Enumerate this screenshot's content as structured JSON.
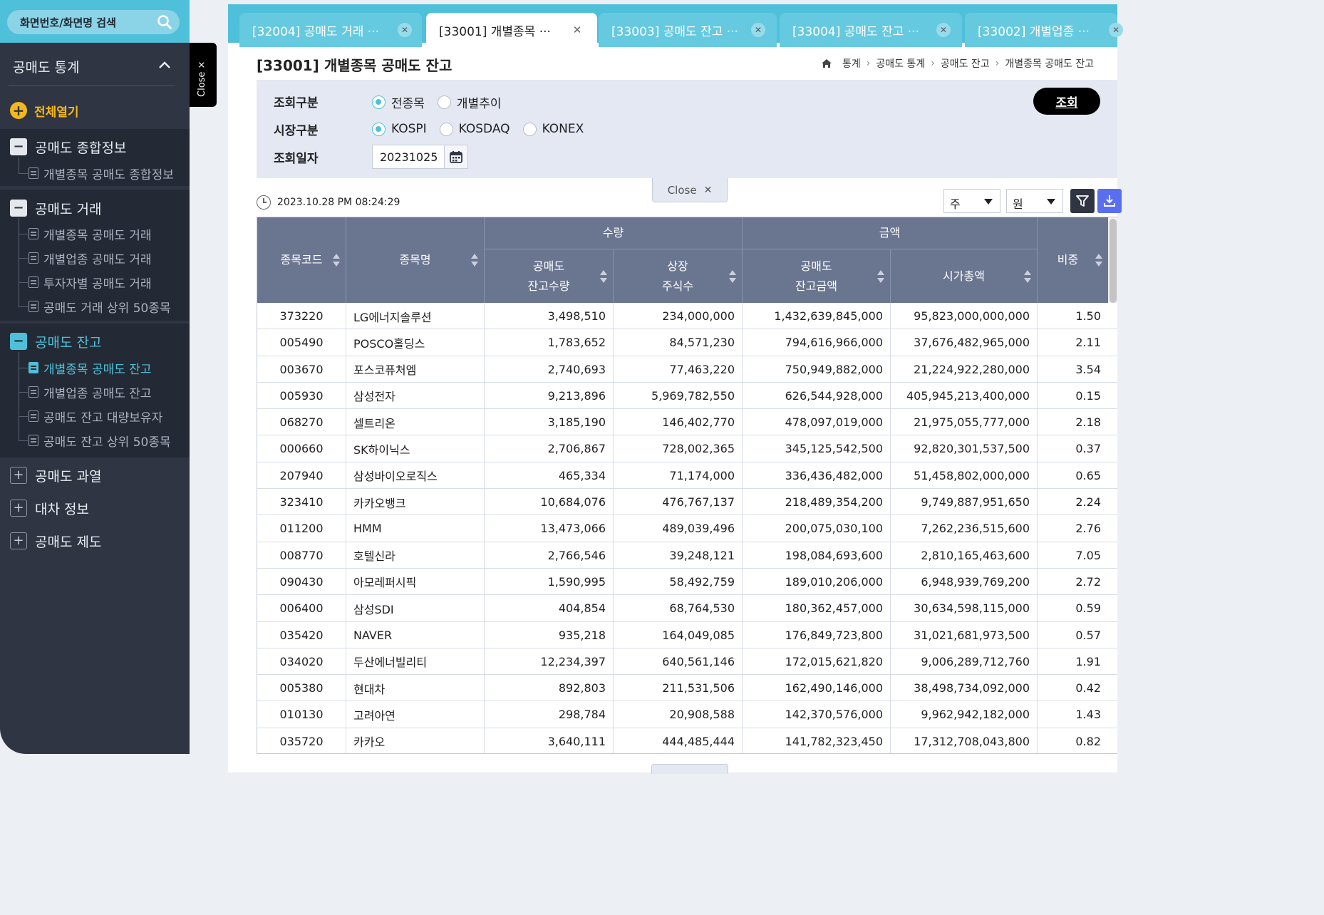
{
  "sidebar": {
    "search_placeholder": "화면번호/화면명 검색",
    "title": "공매도 통계",
    "open_all": "전체열기",
    "close_tab": "Close ×",
    "sections": [
      {
        "label": "공매도 종합정보",
        "items": [
          "개별종목 공매도 종합정보"
        ]
      },
      {
        "label": "공매도 거래",
        "items": [
          "개별종목 공매도 거래",
          "개별업종 공매도 거래",
          "투자자별 공매도 거래",
          "공매도 거래 상위 50종목"
        ]
      },
      {
        "label": "공매도 잔고",
        "items": [
          "개별종목 공매도 잔고",
          "개별업종 공매도 잔고",
          "공매도 잔고 대량보유자",
          "공매도 잔고 상위 50종목"
        ]
      },
      {
        "label": "공매도 과열"
      },
      {
        "label": "대차 정보"
      },
      {
        "label": "공매도 제도"
      }
    ]
  },
  "tabs": [
    {
      "label": "[32004] 공매도 거래 ···"
    },
    {
      "label": "[33001] 개별종목 ···"
    },
    {
      "label": "[33003] 공매도 잔고 ···"
    },
    {
      "label": "[33004] 공매도 잔고 ···"
    },
    {
      "label": "[33002] 개별업종 ···"
    }
  ],
  "page": {
    "title": "[33001] 개별종목 공매도 잔고",
    "breadcrumb": [
      "통계",
      "공매도 통계",
      "공매도 잔고",
      "개별종목 공매도 잔고"
    ]
  },
  "filters": {
    "query_type_label": "조회구분",
    "query_type_options": [
      "전종목",
      "개별추이"
    ],
    "market_label": "시장구분",
    "market_options": [
      "KOSPI",
      "KOSDAQ",
      "KONEX"
    ],
    "date_label": "조회일자",
    "date_value": "20231025",
    "query_button": "조회",
    "close_label": "Close"
  },
  "toolbar": {
    "timestamp": "2023.10.28 PM 08:24:29",
    "unit_shares": "주",
    "unit_currency": "원"
  },
  "table": {
    "headers": {
      "code": "종목코드",
      "name": "종목명",
      "qty_group": "수량",
      "amount_group": "금액",
      "short_qty_1": "공매도",
      "short_qty_2": "잔고수량",
      "listed_1": "상장",
      "listed_2": "주식수",
      "short_amt_1": "공매도",
      "short_amt_2": "잔고금액",
      "mktcap": "시가총액",
      "ratio": "비중"
    },
    "rows": [
      [
        "373220",
        "LG에너지솔루션",
        "3,498,510",
        "234,000,000",
        "1,432,639,845,000",
        "95,823,000,000,000",
        "1.50"
      ],
      [
        "005490",
        "POSCO홀딩스",
        "1,783,652",
        "84,571,230",
        "794,616,966,000",
        "37,676,482,965,000",
        "2.11"
      ],
      [
        "003670",
        "포스코퓨처엠",
        "2,740,693",
        "77,463,220",
        "750,949,882,000",
        "21,224,922,280,000",
        "3.54"
      ],
      [
        "005930",
        "삼성전자",
        "9,213,896",
        "5,969,782,550",
        "626,544,928,000",
        "405,945,213,400,000",
        "0.15"
      ],
      [
        "068270",
        "셀트리온",
        "3,185,190",
        "146,402,770",
        "478,097,019,000",
        "21,975,055,777,000",
        "2.18"
      ],
      [
        "000660",
        "SK하이닉스",
        "2,706,867",
        "728,002,365",
        "345,125,542,500",
        "92,820,301,537,500",
        "0.37"
      ],
      [
        "207940",
        "삼성바이오로직스",
        "465,334",
        "71,174,000",
        "336,436,482,000",
        "51,458,802,000,000",
        "0.65"
      ],
      [
        "323410",
        "카카오뱅크",
        "10,684,076",
        "476,767,137",
        "218,489,354,200",
        "9,749,887,951,650",
        "2.24"
      ],
      [
        "011200",
        "HMM",
        "13,473,066",
        "489,039,496",
        "200,075,030,100",
        "7,262,236,515,600",
        "2.76"
      ],
      [
        "008770",
        "호텔신라",
        "2,766,546",
        "39,248,121",
        "198,084,693,600",
        "2,810,165,463,600",
        "7.05"
      ],
      [
        "090430",
        "아모레퍼시픽",
        "1,590,995",
        "58,492,759",
        "189,010,206,000",
        "6,948,939,769,200",
        "2.72"
      ],
      [
        "006400",
        "삼성SDI",
        "404,854",
        "68,764,530",
        "180,362,457,000",
        "30,634,598,115,000",
        "0.59"
      ],
      [
        "035420",
        "NAVER",
        "935,218",
        "164,049,085",
        "176,849,723,800",
        "31,021,681,973,500",
        "0.57"
      ],
      [
        "034020",
        "두산에너빌리티",
        "12,234,397",
        "640,561,146",
        "172,015,621,820",
        "9,006,289,712,760",
        "1.91"
      ],
      [
        "005380",
        "현대차",
        "892,803",
        "211,531,506",
        "162,490,146,000",
        "38,498,734,092,000",
        "0.42"
      ],
      [
        "010130",
        "고려아연",
        "298,784",
        "20,908,588",
        "142,370,576,000",
        "9,962,942,182,000",
        "1.43"
      ],
      [
        "035720",
        "카카오",
        "3,640,111",
        "444,485,444",
        "141,782,323,450",
        "17,312,708,043,800",
        "0.82"
      ]
    ]
  },
  "colors": {
    "accent": "#4fc0d9",
    "sidebar_bg": "#2f3542",
    "header_bg": "#6a7590",
    "highlight": "#f4b81b"
  }
}
